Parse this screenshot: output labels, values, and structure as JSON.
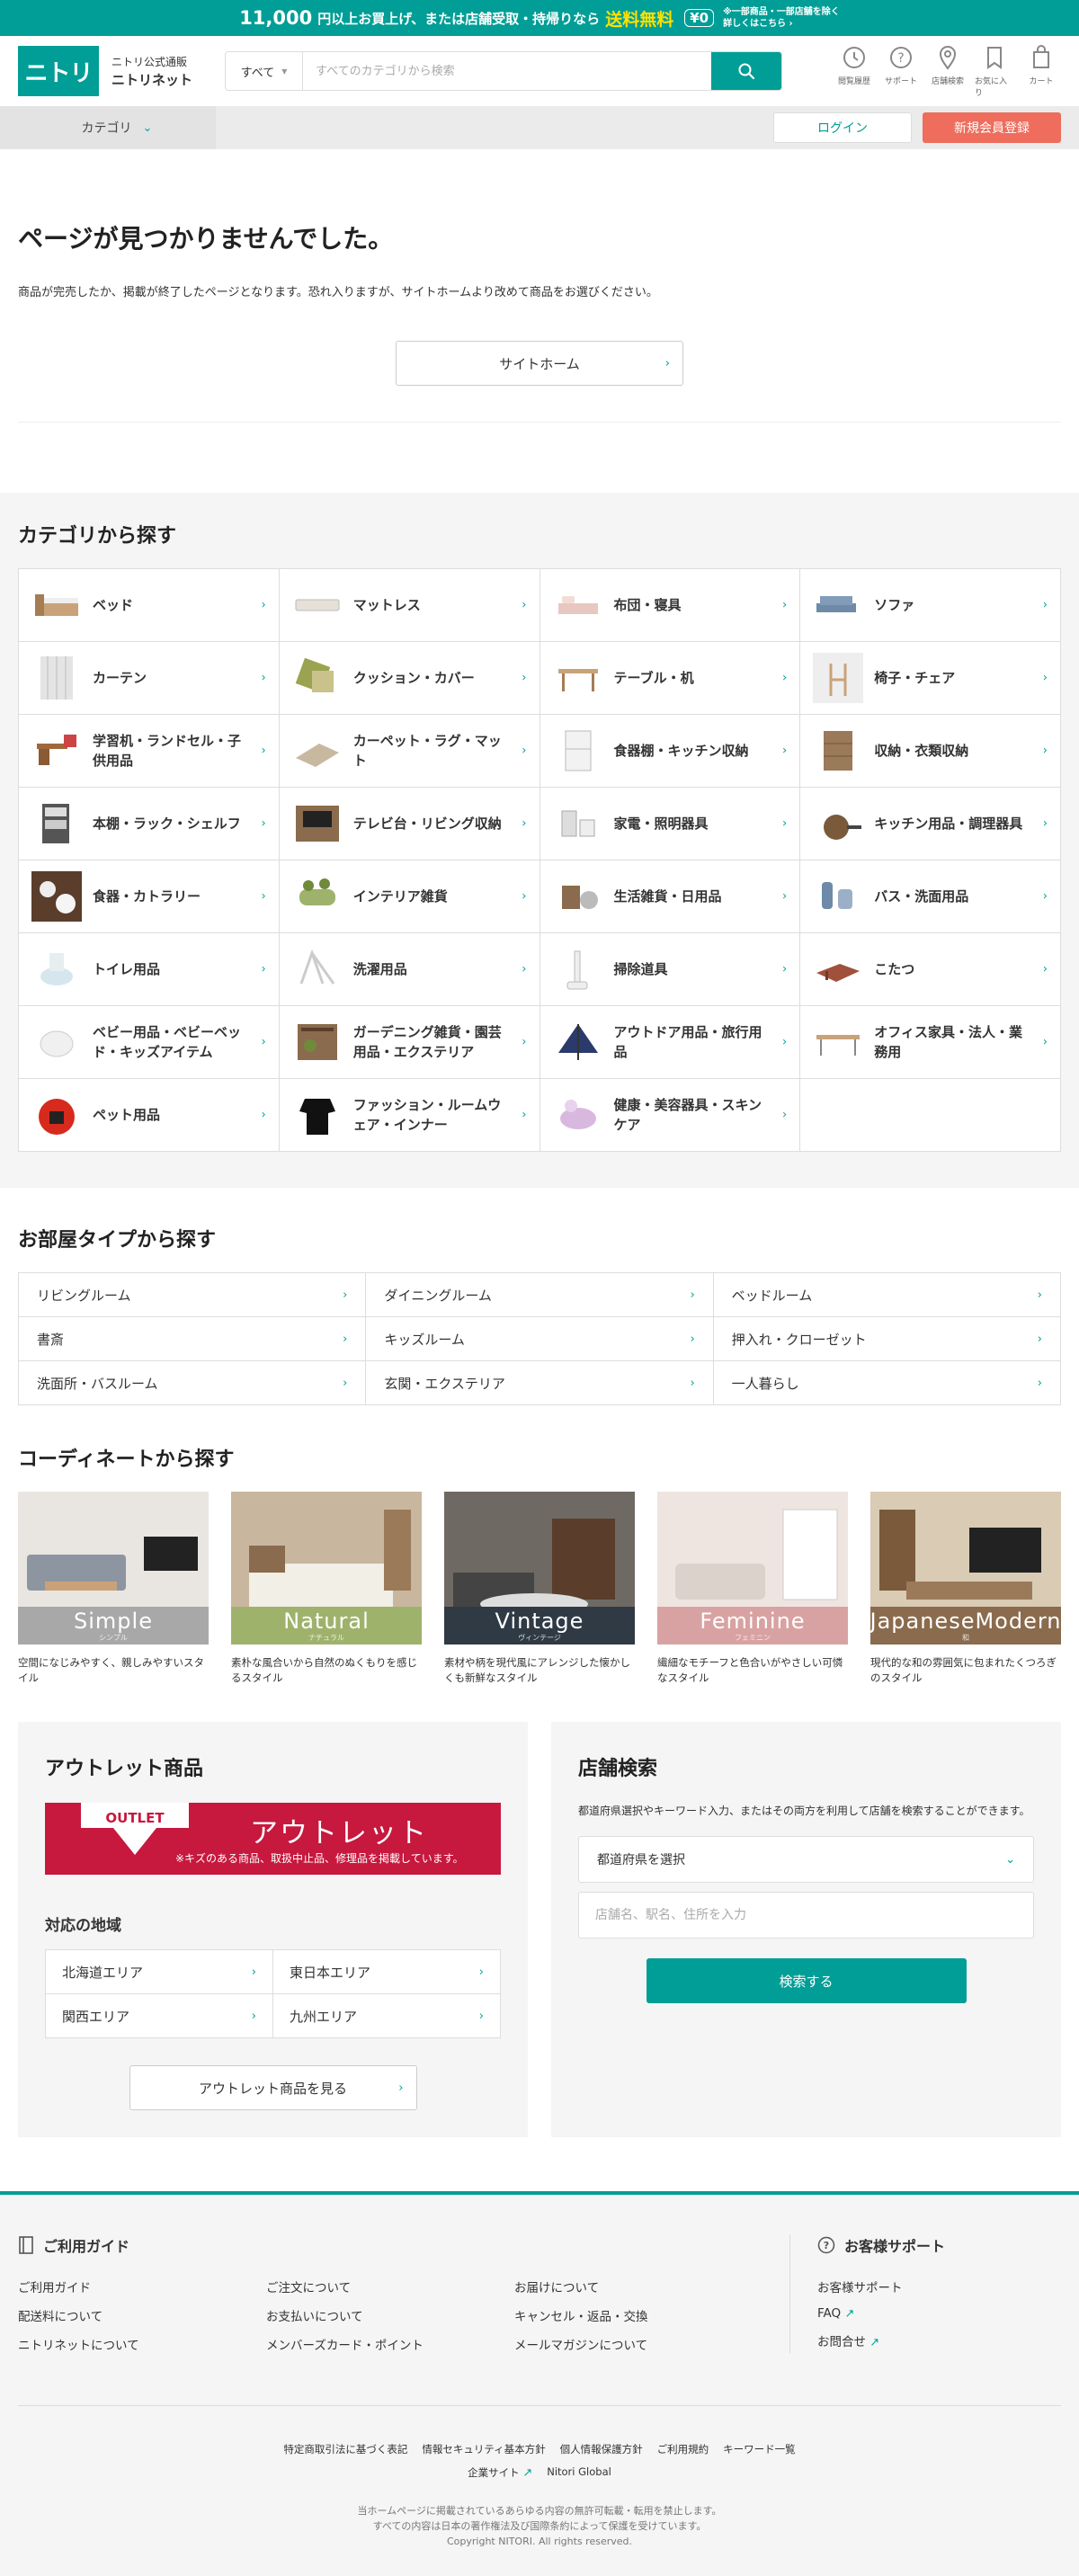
{
  "banner": {
    "amount": "11,000",
    "text1": "円以上お買上げ、または店舗受取・持帰りなら",
    "free": "送料無料",
    "badge": "¥0",
    "note1": "※一部商品・一部店舗を除く",
    "note2": "詳しくはこちら ›",
    "bg_color": "#009e96"
  },
  "header": {
    "logo_text": "ニトリ",
    "brand_sub": "ニトリ公式通販",
    "brand_name": "ニトリネット",
    "search_scope": "すべて",
    "search_placeholder": "すべてのカテゴリから検索",
    "icons": [
      {
        "label": "閲覧履歴",
        "icon": "history-icon"
      },
      {
        "label": "サポート",
        "icon": "help-icon"
      },
      {
        "label": "店舗検索",
        "icon": "pin-icon"
      },
      {
        "label": "お気に入り",
        "icon": "favorite-icon"
      },
      {
        "label": "カート",
        "icon": "cart-icon"
      }
    ]
  },
  "nav": {
    "category": "カテゴリ",
    "login": "ログイン",
    "register": "新規会員登録",
    "register_color": "#ee6d5d"
  },
  "notfound": {
    "title": "ページが見つかりませんでした。",
    "message": "商品が完売したか、掲載が終了したページとなります。恐れ入りますが、サイトホームより改めて商品をお選びください。",
    "home_button": "サイトホーム"
  },
  "categories": {
    "title": "カテゴリから探す",
    "items": [
      "ベッド",
      "マットレス",
      "布団・寝具",
      "ソファ",
      "カーテン",
      "クッション・カバー",
      "テーブル・机",
      "椅子・チェア",
      "学習机・ランドセル・子供用品",
      "カーペット・ラグ・マット",
      "食器棚・キッチン収納",
      "収納・衣類収納",
      "本棚・ラック・シェルフ",
      "テレビ台・リビング収納",
      "家電・照明器具",
      "キッチン用品・調理器具",
      "食器・カトラリー",
      "インテリア雑貨",
      "生活雑貨・日用品",
      "バス・洗面用品",
      "トイレ用品",
      "洗濯用品",
      "掃除道具",
      "こたつ",
      "ベビー用品・ベビーベッド・キッズアイテム",
      "ガーデニング雑貨・園芸用品・エクステリア",
      "アウトドア用品・旅行用品",
      "オフィス家具・法人・業務用",
      "ペット用品",
      "ファッション・ルームウェア・インナー",
      "健康・美容器具・スキンケア"
    ]
  },
  "rooms": {
    "title": "お部屋タイプから探す",
    "items": [
      "リビングルーム",
      "ダイニングルーム",
      "ベッドルーム",
      "書斎",
      "キッズルーム",
      "押入れ・クローゼット",
      "洗面所・バスルーム",
      "玄関・エクステリア",
      "一人暮らし"
    ]
  },
  "coordinate": {
    "title": "コーディネートから探す",
    "items": [
      {
        "en": "Simple",
        "jp": "シンプル",
        "desc": "空間になじみやすく、親しみやすいスタイル",
        "color": "#a8a8a8"
      },
      {
        "en": "Natural",
        "jp": "ナチュラル",
        "desc": "素朴な風合いから自然のぬくもりを感じるスタイル",
        "color": "#9fb26c"
      },
      {
        "en": "Vintage",
        "jp": "ヴィンテージ",
        "desc": "素材や柄を現代風にアレンジした懐かしくも新鮮なスタイル",
        "color": "#2f3a45"
      },
      {
        "en": "Feminine",
        "jp": "フェミニン",
        "desc": "繊細なモチーフと色合いがやさしい可憐なスタイル",
        "color": "#d9a2a2"
      },
      {
        "en": "JapaneseModern",
        "jp": "和",
        "desc": "現代的な和の雰囲気に包まれたくつろぎのスタイル",
        "color": "#8a6b4d"
      }
    ]
  },
  "outlet": {
    "title": "アウトレット商品",
    "banner_label": "OUTLET",
    "banner_title": "アウトレット",
    "banner_sub": "※キズのある商品、取扱中止品、修理品を掲載しています。",
    "area_title": "対応の地域",
    "areas": [
      "北海道エリア",
      "東日本エリア",
      "関西エリア",
      "九州エリア"
    ],
    "button": "アウトレット商品を見る"
  },
  "store": {
    "title": "店舗検索",
    "desc": "都道府県選択やキーワード入力、またはその両方を利用して店舗を検索することができます。",
    "pref_select": "都道府県を選択",
    "keyword_placeholder": "店舗名、駅名、住所を入力",
    "button": "検索する"
  },
  "footer": {
    "guide_title": "ご利用ガイド",
    "guide_links": [
      "ご利用ガイド",
      "ご注文について",
      "お届けについて",
      "配送料について",
      "お支払いについて",
      "キャンセル・返品・交換",
      "ニトリネットについて",
      "メンバーズカード・ポイント",
      "メールマガジンについて"
    ],
    "support_title": "お客様サポート",
    "support_links": [
      "お客様サポート",
      "FAQ",
      "お問合せ"
    ],
    "bottom_links1": [
      "特定商取引法に基づく表記",
      "情報セキュリティ基本方針",
      "個人情報保護方針",
      "ご利用規約",
      "キーワード一覧"
    ],
    "bottom_links2": [
      "企業サイト",
      "Nitori Global"
    ],
    "copy1": "当ホームページに掲載されているあらゆる内容の無許可転載・転用を禁止します。",
    "copy2": "すべての内容は日本の著作権法及び国際条約によって保護を受けています。",
    "copy3": "Copyright NITORI. All rights reserved."
  }
}
